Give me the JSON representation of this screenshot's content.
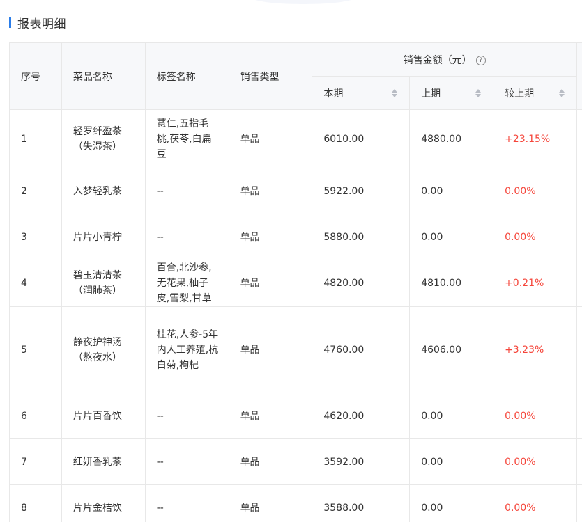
{
  "section": {
    "title": "报表明细"
  },
  "table": {
    "headers": {
      "index": "序号",
      "dish_name": "菜品名称",
      "tag_name": "标签名称",
      "sales_type": "销售类型",
      "sales_amount_group": "销售金额（元）",
      "current": "本期",
      "previous": "上期",
      "change": "较上期"
    },
    "rows": [
      {
        "index": "1",
        "dish_name": "轻罗纤盈茶（失湿茶）",
        "tags": "薏仁,五指毛桃,茯苓,白扁豆",
        "type": "单品",
        "current": "6010.00",
        "previous": "4880.00",
        "change": "+23.15%"
      },
      {
        "index": "2",
        "dish_name": "入梦轻乳茶",
        "tags": "--",
        "type": "单品",
        "current": "5922.00",
        "previous": "0.00",
        "change": "0.00%"
      },
      {
        "index": "3",
        "dish_name": "片片小青柠",
        "tags": "--",
        "type": "单品",
        "current": "5880.00",
        "previous": "0.00",
        "change": "0.00%"
      },
      {
        "index": "4",
        "dish_name": "碧玉清清茶（润肺茶）",
        "tags": "百合,北沙参,无花果,柚子皮,雪梨,甘草",
        "type": "单品",
        "current": "4820.00",
        "previous": "4810.00",
        "change": "+0.21%"
      },
      {
        "index": "5",
        "dish_name": "静夜护神汤（熬夜水）",
        "tags": "桂花,人参-5年内人工养殖,杭白菊,枸杞",
        "type": "单品",
        "current": "4760.00",
        "previous": "4606.00",
        "change": "+3.23%"
      },
      {
        "index": "6",
        "dish_name": "片片百香饮",
        "tags": "--",
        "type": "单品",
        "current": "4620.00",
        "previous": "0.00",
        "change": "0.00%"
      },
      {
        "index": "7",
        "dish_name": "红妍香乳茶",
        "tags": "--",
        "type": "单品",
        "current": "3592.00",
        "previous": "0.00",
        "change": "0.00%"
      },
      {
        "index": "8",
        "dish_name": "片片金桔饮",
        "tags": "--",
        "type": "单品",
        "current": "3588.00",
        "previous": "0.00",
        "change": "0.00%"
      }
    ]
  },
  "icons": {
    "help": "question-circle-icon",
    "sort": "sort-caret-icon"
  },
  "colors": {
    "accent": "#2b7de9",
    "change_text": "#f5453a",
    "header_bg": "#f7f8fa",
    "border": "#e8e8e8"
  }
}
